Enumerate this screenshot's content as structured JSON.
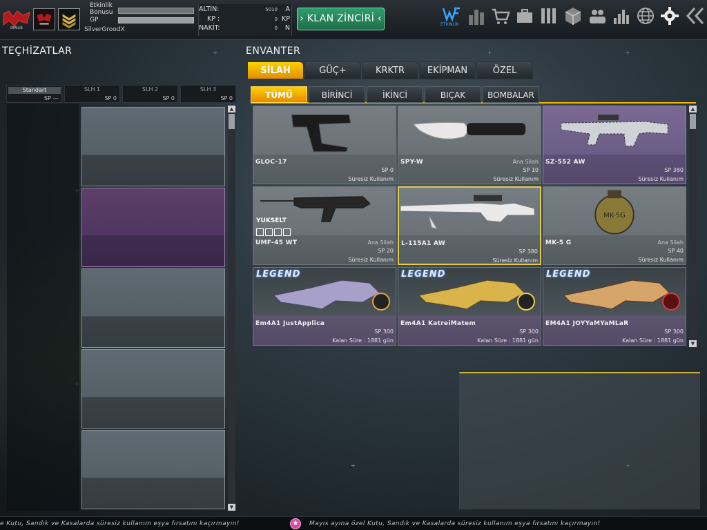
{
  "header": {
    "bonus_label": "Etkinlik Bonusu",
    "gp_label": "GP",
    "player_name": "SilverGroodX",
    "currency": [
      {
        "label": "ALTIN:",
        "value": "5010",
        "unit": "A"
      },
      {
        "label": "KP :",
        "value": "0",
        "unit": "KP"
      },
      {
        "label": "NAKİT:",
        "value": "0",
        "unit": "N"
      }
    ],
    "klan_button": "› KLAN ZİNCİRİ ‹",
    "etkinlik_label": "ETKİNLİK",
    "nav_icons": [
      "etkinlik-logo-icon",
      "stats-building-icon",
      "shop-cart-icon",
      "briefcase-icon",
      "inventory-icon",
      "crate-icon",
      "friends-icon",
      "ranking-icon",
      "globe-icon",
      "settings-gear-icon",
      "exit-arrow-icon"
    ]
  },
  "left_panel": {
    "title": "TEÇHİZATLAR",
    "slot_tabs": [
      {
        "name": "Standart",
        "sp": "SP ---",
        "active": true
      },
      {
        "name": "SLH 1",
        "sp": "SP 0"
      },
      {
        "name": "SLH 2",
        "sp": "SP 0"
      },
      {
        "name": "SLH 3",
        "sp": "SP 0"
      }
    ]
  },
  "right_panel": {
    "title": "ENVANTER",
    "main_tabs": [
      "SİLAH",
      "GÜÇ+",
      "KRKTR",
      "EKİPMAN",
      "ÖZEL"
    ],
    "sub_tabs": [
      "TÜMÜ",
      "BİRİNCİ",
      "İKİNCİ",
      "BIÇAK",
      "BOMBALAR"
    ],
    "items": [
      {
        "name": "GLOC-17",
        "category": "",
        "sp": "SP 0",
        "usage": "Süresiz Kullanım",
        "style": "grey"
      },
      {
        "name": "SPY-W",
        "category": "Ana Silah",
        "sp": "SP 10",
        "usage": "Süresiz Kullanım",
        "style": "grey"
      },
      {
        "name": "SZ-552 AW",
        "category": "",
        "sp": "SP 380",
        "usage": "Süresiz Kullanım",
        "style": "purple"
      },
      {
        "name": "UMF-45 WT",
        "category": "Ana Silah",
        "sp": "SP 20",
        "usage": "Süresiz Kullanım",
        "style": "grey",
        "upgrade_label": "YUKSELT"
      },
      {
        "name": "L-115A1 AW",
        "category": "",
        "sp": "SP 380",
        "usage": "Süresiz Kullanım",
        "style": "selected"
      },
      {
        "name": "MK-5 G",
        "category": "Ana Silah",
        "sp": "SP 40",
        "usage": "Süresiz Kullanım",
        "style": "grey",
        "grenade_label": "MK-5G"
      },
      {
        "name": "Em4A1 JustApplica",
        "category": "",
        "sp": "SP 300",
        "usage": "Kalan Süre : 1881 gün",
        "style": "legend",
        "legend": "LEGEND"
      },
      {
        "name": "Em4A1 KatreiMatem",
        "category": "",
        "sp": "SP 300",
        "usage": "Kalan Süre : 1881 gün",
        "style": "legend",
        "legend": "LEGEND"
      },
      {
        "name": "EM4A1 JOYYaMYaMLaR",
        "category": "",
        "sp": "SP 300",
        "usage": "Kalan Süre : 1881 gün",
        "style": "legend",
        "legend": "LEGEND"
      }
    ]
  },
  "ticker": {
    "left_text": "e Kutu, Sandık ve Kasalarda süresiz kullanım eşya fırsatını kaçırmayın!",
    "right_text": "Mayıs ayına özel Kutu, Sandık ve Kasalarda süresiz kullanım eşya fırsatını kaçırmayın!",
    "icon": "★"
  },
  "colors": {
    "accent": "#f2b600",
    "klan_green": "#2f9e6c",
    "purple_rarity": "#6c5d86"
  }
}
